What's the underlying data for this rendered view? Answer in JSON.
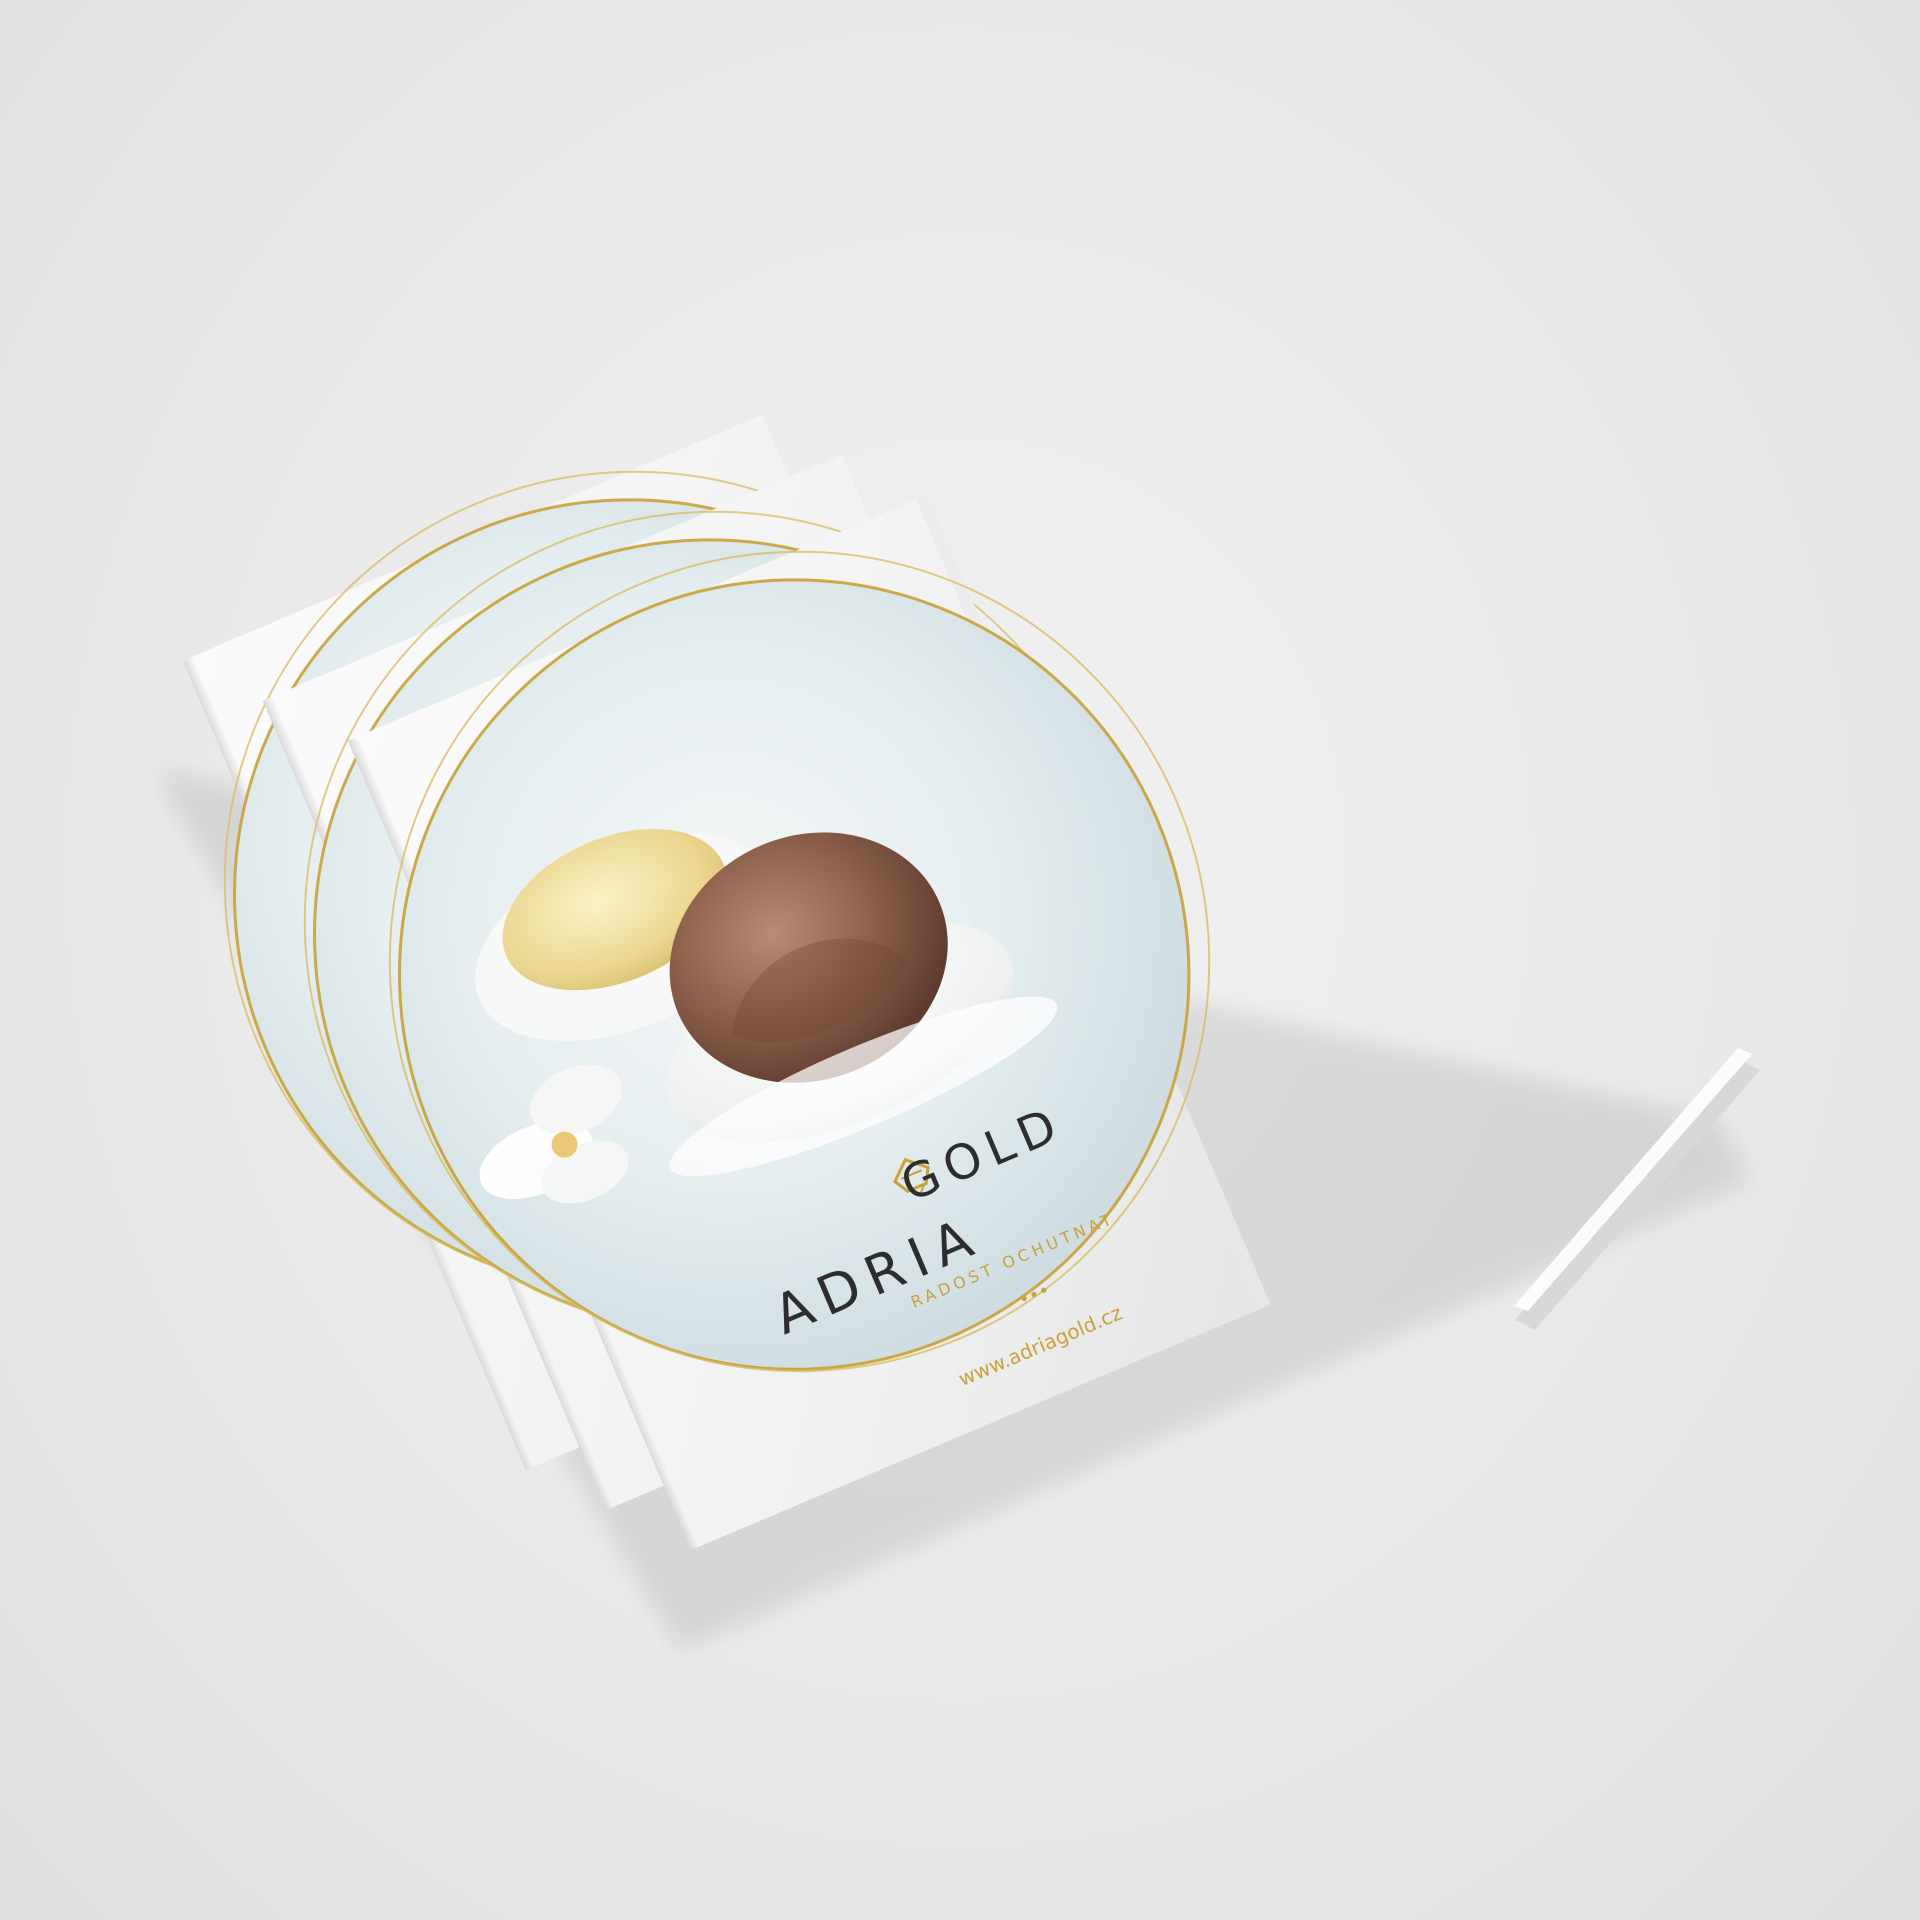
{
  "brochure": {
    "brand_left": "ADRIA",
    "brand_right": "GOLD",
    "tagline": "RADOST OCHUTNAT",
    "website": "www.adriagold.cz",
    "dots": "•••"
  },
  "colors": {
    "background": "#e9e9e9",
    "paper": "#f7f7f7",
    "gold": "#c8a23a",
    "brand_dark": "#2d2d2d",
    "ice_cream_chocolate": "#8a5a47",
    "ice_cream_vanilla": "#f1e2ad",
    "sky_blue": "#d7e8ee"
  },
  "icons": {
    "logo": "ice-cream-cup-logo-icon"
  },
  "copy_count": 3
}
